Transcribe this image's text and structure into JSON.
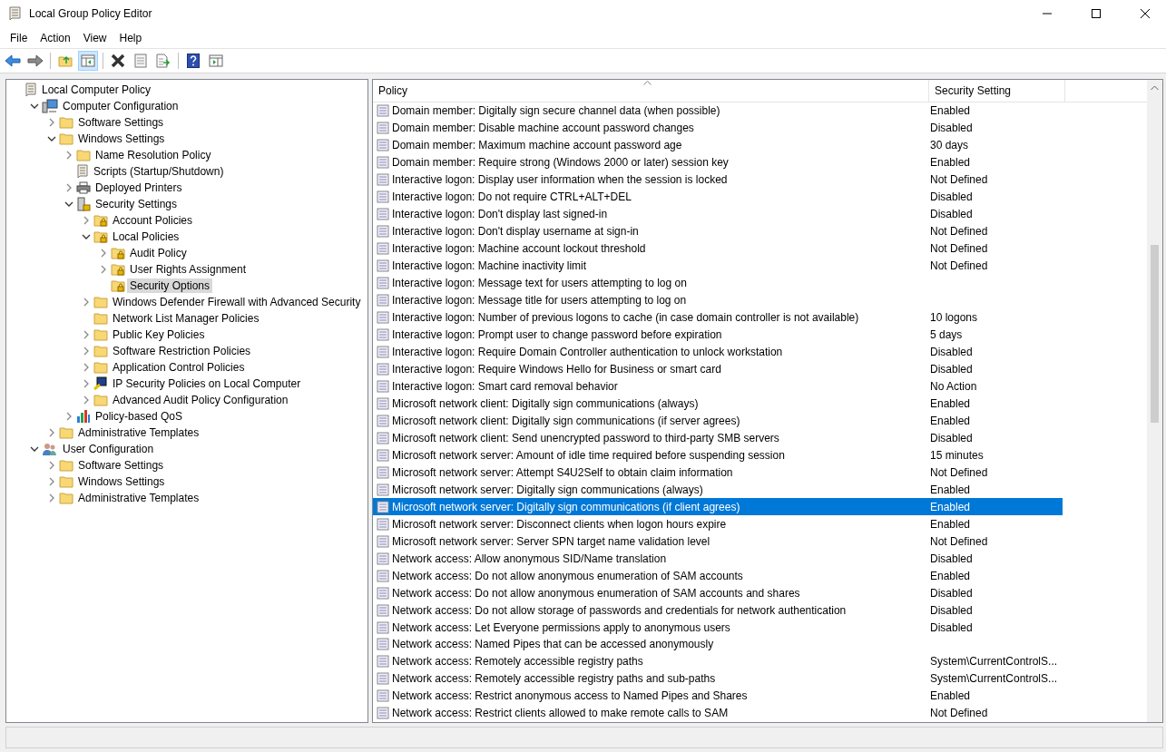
{
  "window": {
    "title": "Local Group Policy Editor"
  },
  "menu": [
    "File",
    "Action",
    "View",
    "Help"
  ],
  "toolbar": [
    {
      "kind": "back"
    },
    {
      "kind": "forward"
    },
    {
      "kind": "sep"
    },
    {
      "kind": "up"
    },
    {
      "kind": "showtree",
      "selected": true
    },
    {
      "kind": "sep"
    },
    {
      "kind": "delete"
    },
    {
      "kind": "properties"
    },
    {
      "kind": "export"
    },
    {
      "kind": "sep"
    },
    {
      "kind": "help"
    },
    {
      "kind": "showaction"
    }
  ],
  "tree": [
    {
      "label": "Local Computer Policy",
      "kind": "policy",
      "selected": false,
      "children": [
        {
          "label": "Computer Configuration",
          "kind": "computer",
          "expandable": true,
          "expanded": true,
          "selected": false,
          "children": [
            {
              "label": "Software Settings",
              "kind": "folder",
              "expandable": true,
              "expanded": false,
              "selected": false
            },
            {
              "label": "Windows Settings",
              "kind": "folder",
              "expandable": true,
              "expanded": true,
              "selected": false,
              "children": [
                {
                  "label": "Name Resolution Policy",
                  "kind": "folder",
                  "expandable": true,
                  "expanded": false,
                  "selected": false
                },
                {
                  "label": "Scripts (Startup/Shutdown)",
                  "kind": "script",
                  "expandable": false,
                  "selected": false
                },
                {
                  "label": "Deployed Printers",
                  "kind": "printer",
                  "expandable": true,
                  "expanded": false,
                  "selected": false
                },
                {
                  "label": "Security Settings",
                  "kind": "security",
                  "expandable": true,
                  "expanded": true,
                  "selected": false,
                  "children": [
                    {
                      "label": "Account Policies",
                      "kind": "lockfolder",
                      "expandable": true,
                      "expanded": false,
                      "selected": false
                    },
                    {
                      "label": "Local Policies",
                      "kind": "lockfolder",
                      "expandable": true,
                      "expanded": true,
                      "selected": false,
                      "children": [
                        {
                          "label": "Audit Policy",
                          "kind": "lockfolder",
                          "expandable": true,
                          "expanded": false,
                          "selected": false
                        },
                        {
                          "label": "User Rights Assignment",
                          "kind": "lockfolder",
                          "expandable": true,
                          "expanded": false,
                          "selected": false
                        },
                        {
                          "label": "Security Options",
                          "kind": "lockfolder",
                          "expandable": false,
                          "selected": true
                        }
                      ]
                    },
                    {
                      "label": "Windows Defender Firewall with Advanced Security",
                      "kind": "folder",
                      "expandable": true,
                      "expanded": false,
                      "selected": false
                    },
                    {
                      "label": "Network List Manager Policies",
                      "kind": "folder",
                      "expandable": false,
                      "selected": false
                    },
                    {
                      "label": "Public Key Policies",
                      "kind": "folder",
                      "expandable": true,
                      "expanded": false,
                      "selected": false
                    },
                    {
                      "label": "Software Restriction Policies",
                      "kind": "folder",
                      "expandable": true,
                      "expanded": false,
                      "selected": false
                    },
                    {
                      "label": "Application Control Policies",
                      "kind": "folder",
                      "expandable": true,
                      "expanded": false,
                      "selected": false
                    },
                    {
                      "label": "IP Security Policies on Local Computer",
                      "kind": "ipsec",
                      "expandable": true,
                      "expanded": false,
                      "selected": false
                    },
                    {
                      "label": "Advanced Audit Policy Configuration",
                      "kind": "folder",
                      "expandable": true,
                      "expanded": false,
                      "selected": false
                    }
                  ]
                },
                {
                  "label": "Policy-based QoS",
                  "kind": "chart",
                  "expandable": true,
                  "expanded": false,
                  "selected": false
                }
              ]
            },
            {
              "label": "Administrative Templates",
              "kind": "folder",
              "expandable": true,
              "expanded": false,
              "selected": false
            }
          ]
        },
        {
          "label": "User Configuration",
          "kind": "user",
          "expandable": true,
          "expanded": true,
          "selected": false,
          "children": [
            {
              "label": "Software Settings",
              "kind": "folder",
              "expandable": true,
              "expanded": false,
              "selected": false
            },
            {
              "label": "Windows Settings",
              "kind": "folder",
              "expandable": true,
              "expanded": false,
              "selected": false
            },
            {
              "label": "Administrative Templates",
              "kind": "folder",
              "expandable": true,
              "expanded": false,
              "selected": false
            }
          ]
        }
      ]
    }
  ],
  "table": {
    "columns": [
      "Policy",
      "Security Setting"
    ],
    "rows": [
      {
        "policy": "Domain member: Digitally sign secure channel data (when possible)",
        "setting": "Enabled",
        "selected": false
      },
      {
        "policy": "Domain member: Disable machine account password changes",
        "setting": "Disabled",
        "selected": false
      },
      {
        "policy": "Domain member: Maximum machine account password age",
        "setting": "30 days",
        "selected": false
      },
      {
        "policy": "Domain member: Require strong (Windows 2000 or later) session key",
        "setting": "Enabled",
        "selected": false
      },
      {
        "policy": "Interactive logon: Display user information when the session is locked",
        "setting": "Not Defined",
        "selected": false
      },
      {
        "policy": "Interactive logon: Do not require CTRL+ALT+DEL",
        "setting": "Disabled",
        "selected": false
      },
      {
        "policy": "Interactive logon: Don't display last signed-in",
        "setting": "Disabled",
        "selected": false
      },
      {
        "policy": "Interactive logon: Don't display username at sign-in",
        "setting": "Not Defined",
        "selected": false
      },
      {
        "policy": "Interactive logon: Machine account lockout threshold",
        "setting": "Not Defined",
        "selected": false
      },
      {
        "policy": "Interactive logon: Machine inactivity limit",
        "setting": "Not Defined",
        "selected": false
      },
      {
        "policy": "Interactive logon: Message text for users attempting to log on",
        "selected": false
      },
      {
        "policy": "Interactive logon: Message title for users attempting to log on",
        "selected": false
      },
      {
        "policy": "Interactive logon: Number of previous logons to cache (in case domain controller is not available)",
        "setting": "10 logons",
        "selected": false
      },
      {
        "policy": "Interactive logon: Prompt user to change password before expiration",
        "setting": "5 days",
        "selected": false
      },
      {
        "policy": "Interactive logon: Require Domain Controller authentication to unlock workstation",
        "setting": "Disabled",
        "selected": false
      },
      {
        "policy": "Interactive logon: Require Windows Hello for Business or smart card",
        "setting": "Disabled",
        "selected": false
      },
      {
        "policy": "Interactive logon: Smart card removal behavior",
        "setting": "No Action",
        "selected": false
      },
      {
        "policy": "Microsoft network client: Digitally sign communications (always)",
        "setting": "Enabled",
        "selected": false
      },
      {
        "policy": "Microsoft network client: Digitally sign communications (if server agrees)",
        "setting": "Enabled",
        "selected": false
      },
      {
        "policy": "Microsoft network client: Send unencrypted password to third-party SMB servers",
        "setting": "Disabled",
        "selected": false
      },
      {
        "policy": "Microsoft network server: Amount of idle time required before suspending session",
        "setting": "15 minutes",
        "selected": false
      },
      {
        "policy": "Microsoft network server: Attempt S4U2Self to obtain claim information",
        "setting": "Not Defined",
        "selected": false
      },
      {
        "policy": "Microsoft network server: Digitally sign communications (always)",
        "setting": "Enabled",
        "selected": false
      },
      {
        "policy": "Microsoft network server: Digitally sign communications (if client agrees)",
        "setting": "Enabled",
        "selected": true
      },
      {
        "policy": "Microsoft network server: Disconnect clients when logon hours expire",
        "setting": "Enabled",
        "selected": false
      },
      {
        "policy": "Microsoft network server: Server SPN target name validation level",
        "setting": "Not Defined",
        "selected": false
      },
      {
        "policy": "Network access: Allow anonymous SID/Name translation",
        "setting": "Disabled",
        "selected": false
      },
      {
        "policy": "Network access: Do not allow anonymous enumeration of SAM accounts",
        "setting": "Enabled",
        "selected": false
      },
      {
        "policy": "Network access: Do not allow anonymous enumeration of SAM accounts and shares",
        "setting": "Disabled",
        "selected": false
      },
      {
        "policy": "Network access: Do not allow storage of passwords and credentials for network authentication",
        "setting": "Disabled",
        "selected": false
      },
      {
        "policy": "Network access: Let Everyone permissions apply to anonymous users",
        "setting": "Disabled",
        "selected": false
      },
      {
        "policy": "Network access: Named Pipes that can be accessed anonymously",
        "selected": false
      },
      {
        "policy": "Network access: Remotely accessible registry paths",
        "setting": "System\\CurrentControlS...",
        "selected": false
      },
      {
        "policy": "Network access: Remotely accessible registry paths and sub-paths",
        "setting": "System\\CurrentControlS...",
        "selected": false
      },
      {
        "policy": "Network access: Restrict anonymous access to Named Pipes and Shares",
        "setting": "Enabled",
        "selected": false
      },
      {
        "policy": "Network access: Restrict clients allowed to make remote calls to SAM",
        "setting": "Not Defined",
        "selected": false
      }
    ]
  }
}
